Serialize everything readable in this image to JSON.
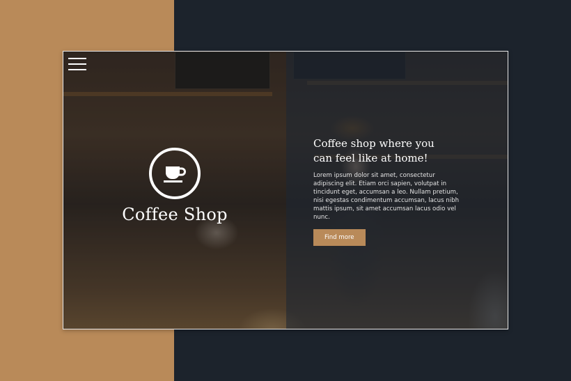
{
  "colors": {
    "accent": "#b98a59",
    "dark_background": "#1c232c",
    "card_border": "#e9e9e9",
    "text_light": "#ffffff"
  },
  "header": {
    "menu_icon": "hamburger-menu-icon"
  },
  "brand": {
    "icon": "coffee-cup-icon",
    "name": "Coffee Shop"
  },
  "hero": {
    "headline_line1": "Coffee shop where you",
    "headline_line2": "can feel like at home!",
    "body": "Lorem ipsum dolor sit amet, consectetur adipiscing elit. Etiam orci sapien, volutpat in tincidunt eget, accumsan a leo. Nullam pretium, nisi egestas condimentum accumsan, lacus nibh mattis ipsum, sit amet accumsan lacus odio vel nunc.",
    "cta_label": "Find more"
  }
}
